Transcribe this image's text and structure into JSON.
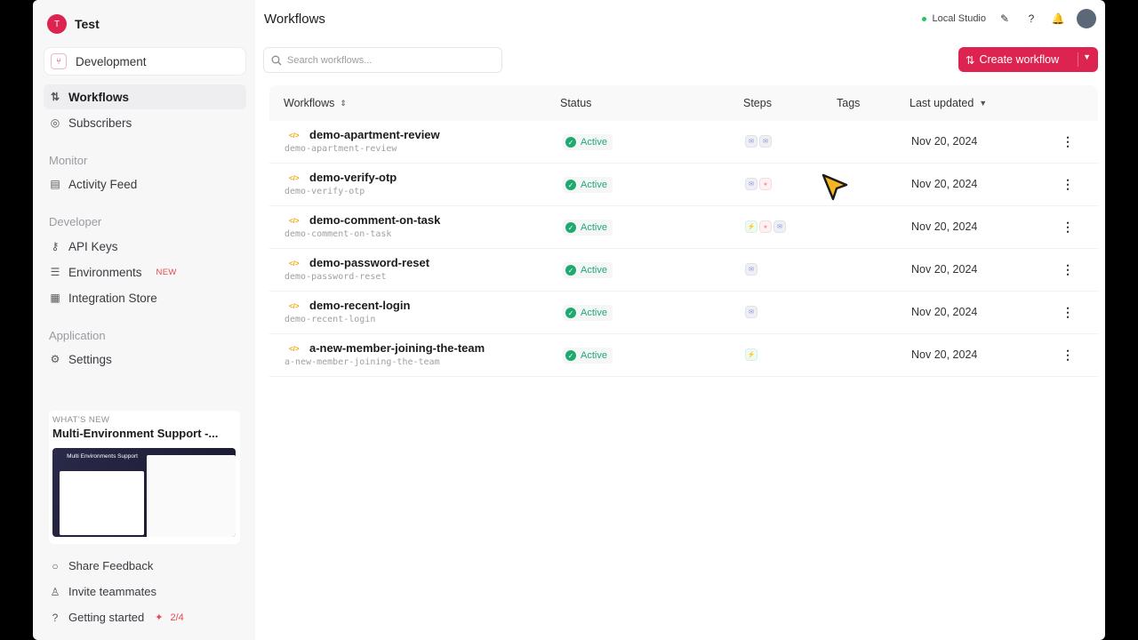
{
  "org": {
    "initial": "T",
    "name": "Test"
  },
  "environment": {
    "label": "Development"
  },
  "nav": {
    "workflows": "Workflows",
    "subscribers": "Subscribers",
    "monitor_section": "Monitor",
    "activity_feed": "Activity Feed",
    "developer_section": "Developer",
    "api_keys": "API Keys",
    "environments": "Environments",
    "environments_badge": "NEW",
    "integration_store": "Integration Store",
    "application_section": "Application",
    "settings": "Settings"
  },
  "whats_new": {
    "kicker": "WHAT'S NEW",
    "title": "Multi-Environment Support -...",
    "card_title": "Multi Environments Support"
  },
  "bottom": {
    "share_feedback": "Share Feedback",
    "invite_teammates": "Invite teammates",
    "getting_started": "Getting started",
    "getting_started_progress": "2/4"
  },
  "header": {
    "title": "Workflows",
    "studio_label": "Local Studio"
  },
  "search": {
    "placeholder": "Search workflows..."
  },
  "create_button": {
    "label": "Create workflow"
  },
  "table": {
    "columns": {
      "workflows": "Workflows",
      "status": "Status",
      "steps": "Steps",
      "tags": "Tags",
      "last_updated": "Last updated"
    },
    "rows": [
      {
        "name": "demo-apartment-review",
        "id": "demo-apartment-review",
        "status": "Active",
        "steps": [
          "blue",
          "blue"
        ],
        "updated": "Nov 20, 2024"
      },
      {
        "name": "demo-verify-otp",
        "id": "demo-verify-otp",
        "status": "Active",
        "steps": [
          "blue",
          "red"
        ],
        "updated": "Nov 20, 2024"
      },
      {
        "name": "demo-comment-on-task",
        "id": "demo-comment-on-task",
        "status": "Active",
        "steps": [
          "green",
          "red",
          "blue"
        ],
        "updated": "Nov 20, 2024"
      },
      {
        "name": "demo-password-reset",
        "id": "demo-password-reset",
        "status": "Active",
        "steps": [
          "blue"
        ],
        "updated": "Nov 20, 2024"
      },
      {
        "name": "demo-recent-login",
        "id": "demo-recent-login",
        "status": "Active",
        "steps": [
          "blue"
        ],
        "updated": "Nov 20, 2024"
      },
      {
        "name": "a-new-member-joining-the-team",
        "id": "a-new-member-joining-the-team",
        "status": "Active",
        "steps": [
          "green"
        ],
        "updated": "Nov 20, 2024"
      }
    ]
  },
  "colors": {
    "brand": "#dd2450",
    "active_green": "#1fa971",
    "workflow_icon": "#f0a300"
  }
}
